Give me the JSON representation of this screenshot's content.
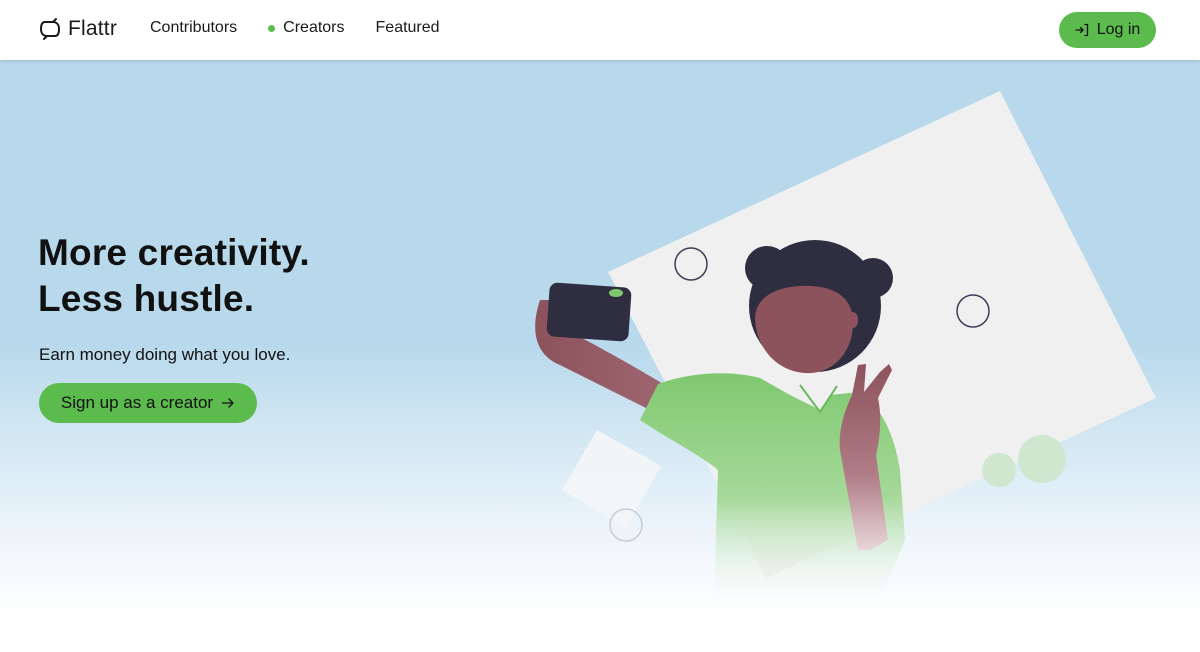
{
  "brand": {
    "name": "Flattr",
    "accent_color": "#5cbb4d",
    "logo_icon": "flattr-leaf-icon"
  },
  "nav": {
    "items": [
      {
        "label": "Contributors",
        "active": false
      },
      {
        "label": "Creators",
        "active": true
      },
      {
        "label": "Featured",
        "active": false
      }
    ],
    "login": {
      "label": "Log in",
      "icon": "log-in-icon"
    }
  },
  "hero": {
    "title_line1": "More creativity.",
    "title_line2": "Less hustle.",
    "subtitle": "Earn money doing what you love.",
    "cta": {
      "label": "Sign up as a creator",
      "icon": "arrow-right-icon"
    },
    "background_color": "#b8d9ec",
    "illustration": "woman-taking-selfie-illustration"
  }
}
